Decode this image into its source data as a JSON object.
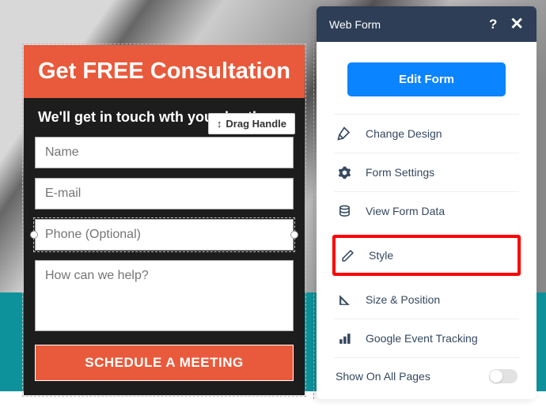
{
  "form": {
    "title": "Get FREE Consultation",
    "subtitle": "We'll get in touch wth you shortly.",
    "drag_handle": "Drag Handle",
    "fields": {
      "name_placeholder": "Name",
      "email_placeholder": "E-mail",
      "phone_placeholder": "Phone (Optional)",
      "message_placeholder": "How can we help?"
    },
    "submit": "SCHEDULE A MEETING"
  },
  "panel": {
    "title": "Web Form",
    "edit_button": "Edit Form",
    "menu": {
      "change_design": "Change Design",
      "form_settings": "Form Settings",
      "view_form_data": "View Form Data",
      "style": "Style",
      "size_position": "Size & Position",
      "google_tracking": "Google Event Tracking"
    },
    "toggle_label": "Show On All Pages"
  }
}
